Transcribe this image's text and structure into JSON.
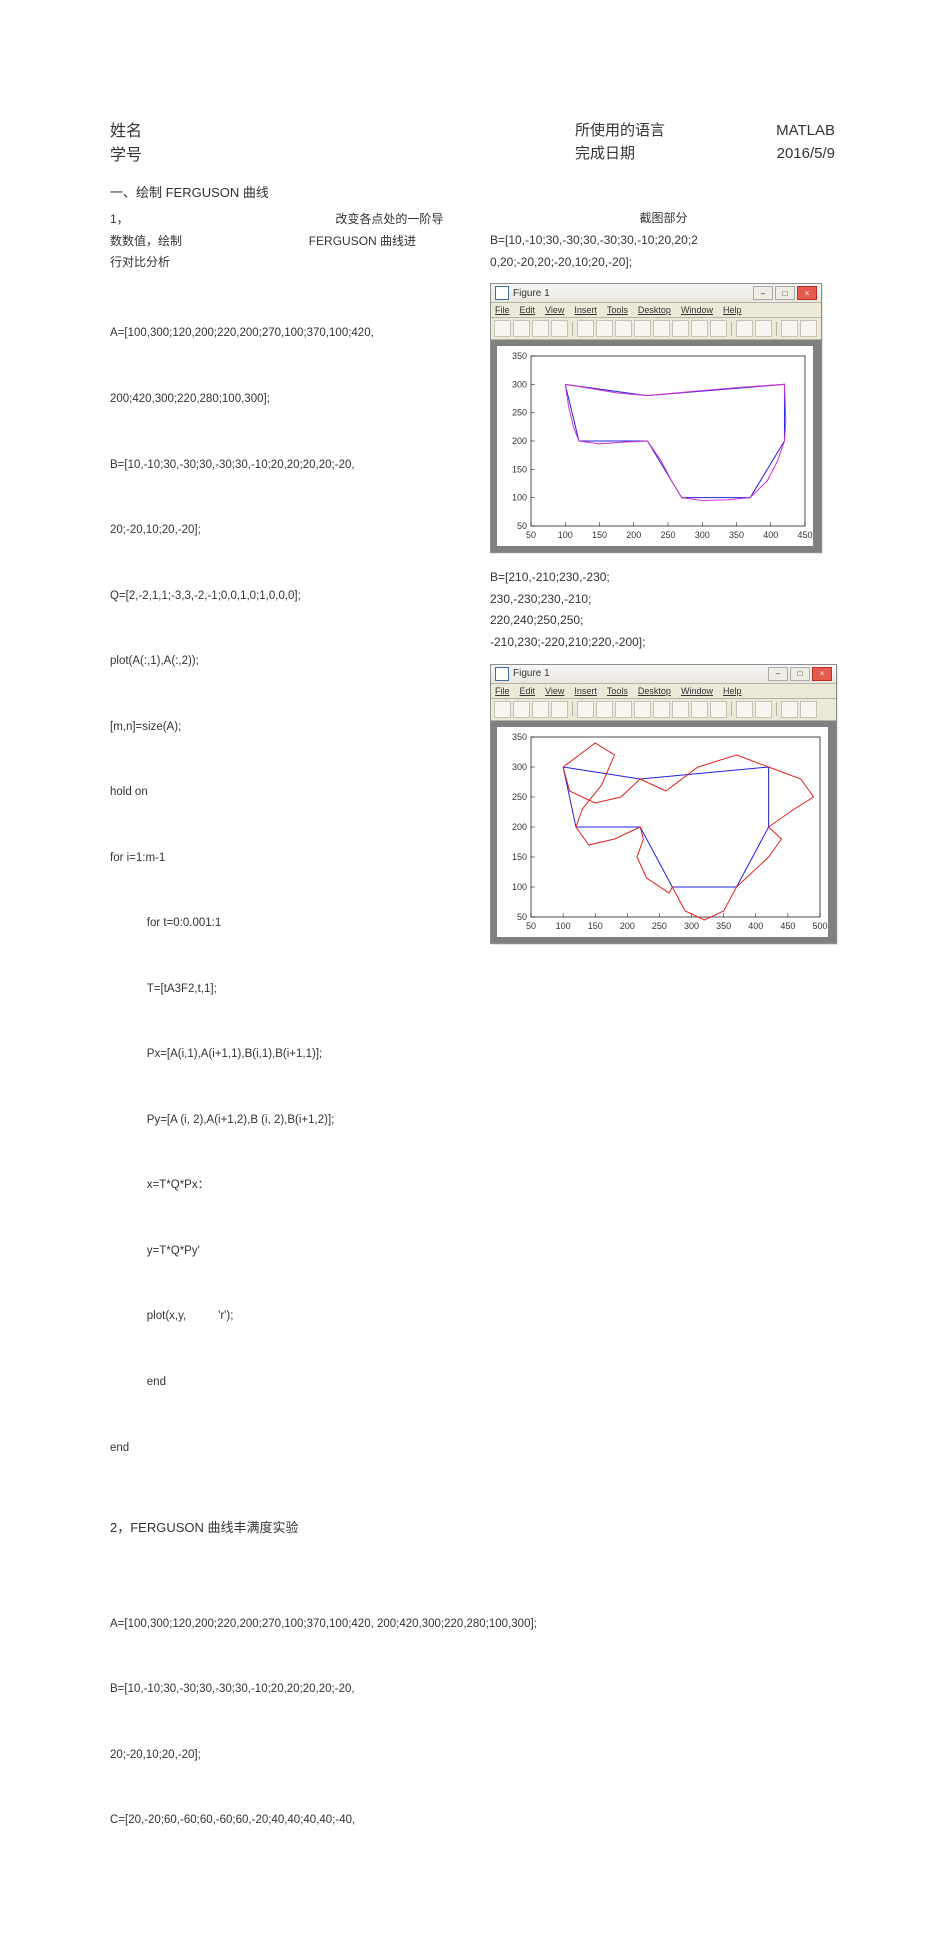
{
  "header": {
    "left": {
      "name_label": "姓名",
      "id_label": "学号"
    },
    "right": {
      "lang_label": "所使用的语言",
      "lang_value": "MATLAB",
      "date_label": "完成日期",
      "date_value": "2016/5/9"
    }
  },
  "section1": {
    "title": "一、绘制 FERGUSON 曲线",
    "p1_prefix": "1，",
    "p1_mid": "改变各点处的一阶导",
    "p1_line2a": "数数值，绘制",
    "p1_line2b": "FERGUSON 曲线进",
    "p1_line3": "行对比分析",
    "code_lines": [
      "A=[100,300;120,200;220,200;270,100;370,100;420,",
      "200;420,300;220,280;100,300];",
      "B=[10,-10;30,-30;30,-30;30,-10;20,20;20,20;-20,",
      "20;-20,10;20,-20];",
      "Q=[2,-2,1,1;-3,3,-2,-1;0,0,1,0;1,0,0,0];",
      "plot(A(:,1),A(:,2));",
      "[m,n]=size(A);",
      "hold on",
      "for i=1:m-1",
      "    for t=0:0.001:1",
      "    T=[tA3F2,t,1];",
      "    Px=[A(i,1),A(i+1,1),B(i,1),B(i+1,1)];",
      "    Py=[A (i, 2),A(i+1,2),B (i, 2),B(i+1,2)];",
      "    x=T*Q*Px：",
      "    y=T*Q*Py'",
      "    plot(x,y,          'r');",
      "    end",
      "end"
    ]
  },
  "right_col": {
    "screenshot_label": "截图部分",
    "b1_line1": "B=[10,-10;30,-30;30,-30;30,-10;20,20;2",
    "b1_line2": "0,20;-20,20;-20,10;20,-20];",
    "b2_line1": "B=[210,-210;230,-230;",
    "b2_line2": "230,-230;230,-210;",
    "b2_line3": "220,240;250,250;",
    "b2_line4": "-210,230;-220,210;220,-200];"
  },
  "figwin": {
    "title": "Figure 1",
    "menus": [
      "File",
      "Edit",
      "View",
      "Insert",
      "Tools",
      "Desktop",
      "Window",
      "Help"
    ]
  },
  "chart_data": [
    {
      "type": "line",
      "title": "",
      "xlabel": "",
      "ylabel": "",
      "xlim": [
        50,
        450
      ],
      "ylim": [
        50,
        350
      ],
      "x_ticks": [
        50,
        100,
        150,
        200,
        250,
        300,
        350,
        400,
        450
      ],
      "y_ticks": [
        50,
        100,
        150,
        200,
        250,
        300,
        350
      ],
      "series": [
        {
          "name": "polygon-blue",
          "color": "#2020e0",
          "points": [
            [
              100,
              300
            ],
            [
              120,
              200
            ],
            [
              220,
              200
            ],
            [
              270,
              100
            ],
            [
              370,
              100
            ],
            [
              420,
              200
            ],
            [
              420,
              300
            ],
            [
              220,
              280
            ],
            [
              100,
              300
            ]
          ]
        },
        {
          "name": "ferguson-magenta",
          "color": "#d030d0",
          "points": [
            [
              100,
              300
            ],
            [
              105,
              260
            ],
            [
              112,
              225
            ],
            [
              120,
              200
            ],
            [
              150,
              195
            ],
            [
              185,
              198
            ],
            [
              220,
              200
            ],
            [
              240,
              165
            ],
            [
              255,
              130
            ],
            [
              270,
              100
            ],
            [
              300,
              95
            ],
            [
              335,
              96
            ],
            [
              370,
              100
            ],
            [
              395,
              130
            ],
            [
              410,
              165
            ],
            [
              420,
              200
            ],
            [
              422,
              235
            ],
            [
              421,
              268
            ],
            [
              420,
              300
            ],
            [
              360,
              295
            ],
            [
              290,
              288
            ],
            [
              220,
              280
            ],
            [
              175,
              285
            ],
            [
              135,
              293
            ],
            [
              100,
              300
            ]
          ]
        }
      ]
    },
    {
      "type": "line",
      "title": "",
      "xlabel": "",
      "ylabel": "",
      "xlim": [
        50,
        500
      ],
      "ylim": [
        50,
        350
      ],
      "x_ticks": [
        50,
        100,
        150,
        200,
        250,
        300,
        350,
        400,
        450,
        500
      ],
      "y_ticks": [
        50,
        100,
        150,
        200,
        250,
        300,
        350
      ],
      "series": [
        {
          "name": "polygon-blue",
          "color": "#2020e0",
          "points": [
            [
              100,
              300
            ],
            [
              120,
              200
            ],
            [
              220,
              200
            ],
            [
              270,
              100
            ],
            [
              370,
              100
            ],
            [
              420,
              200
            ],
            [
              420,
              300
            ],
            [
              220,
              280
            ],
            [
              100,
              300
            ]
          ]
        },
        {
          "name": "ferguson-red",
          "color": "#e02020",
          "points": [
            [
              100,
              300
            ],
            [
              150,
              340
            ],
            [
              180,
              320
            ],
            [
              160,
              270
            ],
            [
              130,
              230
            ],
            [
              120,
              200
            ],
            [
              140,
              170
            ],
            [
              180,
              180
            ],
            [
              210,
              195
            ],
            [
              220,
              200
            ],
            [
              225,
              180
            ],
            [
              215,
              150
            ],
            [
              230,
              115
            ],
            [
              265,
              90
            ],
            [
              270,
              100
            ],
            [
              290,
              60
            ],
            [
              320,
              45
            ],
            [
              350,
              60
            ],
            [
              370,
              100
            ],
            [
              390,
              120
            ],
            [
              420,
              150
            ],
            [
              440,
              180
            ],
            [
              420,
              200
            ],
            [
              460,
              230
            ],
            [
              490,
              250
            ],
            [
              470,
              280
            ],
            [
              420,
              300
            ],
            [
              370,
              320
            ],
            [
              310,
              300
            ],
            [
              260,
              260
            ],
            [
              220,
              280
            ],
            [
              190,
              250
            ],
            [
              150,
              240
            ],
            [
              110,
              260
            ],
            [
              100,
              300
            ]
          ]
        }
      ]
    }
  ],
  "section2": {
    "title": "2，FERGUSON 曲线丰满度实验",
    "lines": [
      "A=[100,300;120,200;220,200;270,100;370,100;420, 200;420,300;220,280;100,300];",
      "B=[10,-10;30,-30;30,-30;30,-10;20,20;20,20;-20,",
      "20;-20,10;20,-20];",
      "C=[20,-20;60,-60;60,-60;60,-20;40,40;40,40;-40,"
    ]
  }
}
